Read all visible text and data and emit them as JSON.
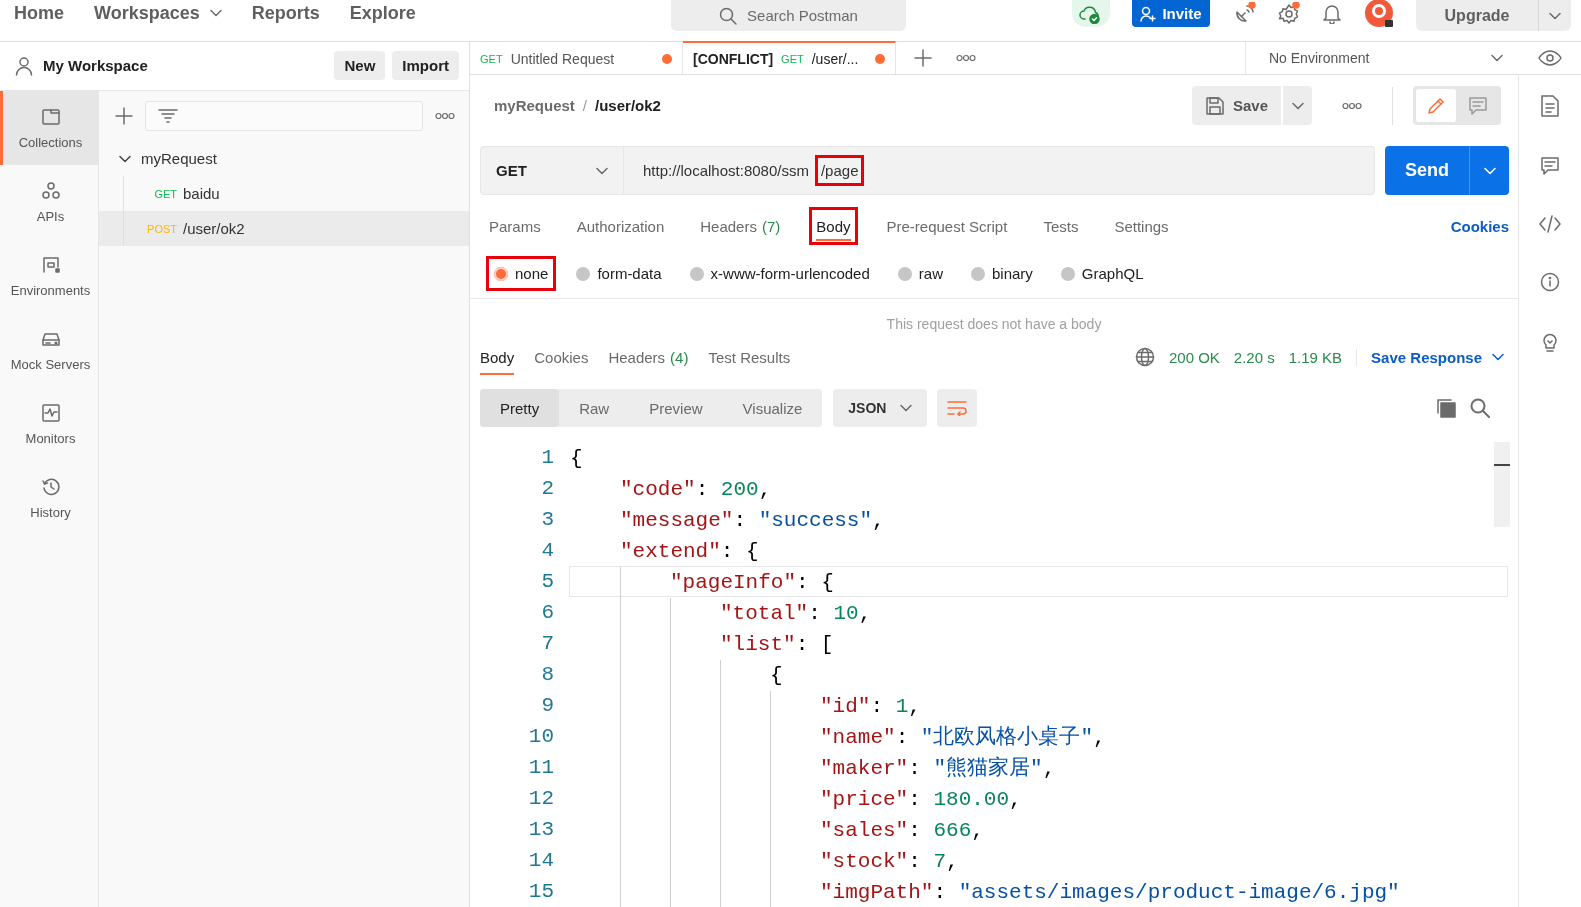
{
  "top_nav": {
    "items": [
      {
        "label": "Home",
        "dropdown": false
      },
      {
        "label": "Workspaces",
        "dropdown": true
      },
      {
        "label": "Reports",
        "dropdown": false
      },
      {
        "label": "Explore",
        "dropdown": false
      }
    ],
    "search": {
      "placeholder": "Search Postman"
    },
    "invite": "Invite",
    "upgrade": "Upgrade"
  },
  "workspace": {
    "name": "My Workspace",
    "buttons": [
      "New",
      "Import"
    ]
  },
  "sidebar": {
    "items": [
      {
        "label": "Collections",
        "kind": "collections",
        "selected": true
      },
      {
        "label": "APIs",
        "kind": "apis",
        "selected": false
      },
      {
        "label": "Environments",
        "kind": "environments",
        "selected": false
      },
      {
        "label": "Mock Servers",
        "kind": "mock",
        "selected": false
      },
      {
        "label": "Monitors",
        "kind": "monitors",
        "selected": false
      },
      {
        "label": "History",
        "kind": "history",
        "selected": false
      }
    ]
  },
  "collections": [
    {
      "name": "myRequest",
      "expanded": true,
      "children": [
        {
          "method": "GET",
          "color": "#0cbb52",
          "name": "baidu",
          "selected": false
        },
        {
          "method": "POST",
          "color": "#ffb400",
          "name": "/user/ok2",
          "selected": true
        }
      ]
    }
  ],
  "tabs": [
    {
      "method": "GET",
      "color": "#0cbb52",
      "title": "Untitled Request",
      "unsaved": true,
      "selected": false
    },
    {
      "tag": "[CONFLICT]",
      "method": "GET",
      "color": "#0cbb52",
      "title": "/user/...",
      "unsaved": true,
      "selected": true
    }
  ],
  "environment": "No Environment",
  "request": {
    "breadcrumb": [
      "myRequest",
      "/user/ok2"
    ],
    "breadcrumb_separator": "/",
    "save": "Save",
    "editor_modes": [
      {
        "kind": "edit",
        "selected": true
      },
      {
        "kind": "comments",
        "selected": false
      }
    ],
    "method": "GET",
    "url_parts": [
      {
        "text": "http://localhost:8080/ssm",
        "annotated": false
      },
      {
        "text": "/page",
        "annotated": true
      }
    ],
    "send": "Send",
    "tabs": [
      {
        "label": "Params",
        "selected": false,
        "annotated": false
      },
      {
        "label": "Authorization",
        "selected": false,
        "annotated": false
      },
      {
        "label": "Headers",
        "count": "(7)",
        "selected": false,
        "annotated": false
      },
      {
        "label": "Body",
        "selected": true,
        "annotated": true
      },
      {
        "label": "Pre-request Script",
        "selected": false,
        "annotated": false
      },
      {
        "label": "Tests",
        "selected": false,
        "annotated": false
      },
      {
        "label": "Settings",
        "selected": false,
        "annotated": false
      }
    ],
    "cookies": "Cookies",
    "body_types": [
      {
        "label": "none",
        "selected": true,
        "annotated": true
      },
      {
        "label": "form-data",
        "selected": false,
        "annotated": false
      },
      {
        "label": "x-www-form-urlencoded",
        "selected": false,
        "annotated": false
      },
      {
        "label": "raw",
        "selected": false,
        "annotated": false
      },
      {
        "label": "binary",
        "selected": false,
        "annotated": false
      },
      {
        "label": "GraphQL",
        "selected": false,
        "annotated": false
      }
    ],
    "body_message": "This request does not have a body"
  },
  "response": {
    "tabs": [
      {
        "label": "Body",
        "selected": true
      },
      {
        "label": "Cookies",
        "selected": false
      },
      {
        "label": "Headers",
        "count": "(4)",
        "selected": false
      },
      {
        "label": "Test Results",
        "selected": false
      }
    ],
    "status": "200 OK",
    "time": "2.20 s",
    "size": "1.19 KB",
    "save": "Save Response",
    "views": [
      {
        "label": "Pretty",
        "selected": true
      },
      {
        "label": "Raw",
        "selected": false
      },
      {
        "label": "Preview",
        "selected": false
      },
      {
        "label": "Visualize",
        "selected": false
      }
    ],
    "format": "JSON",
    "lines": [
      {
        "number": "1",
        "current": false,
        "tokens": [
          {
            "kind": "punct",
            "text": "{"
          }
        ]
      },
      {
        "number": "2",
        "current": false,
        "tokens": [
          {
            "kind": "key",
            "text": "\"code\""
          },
          {
            "kind": "punct",
            "text": ": "
          },
          {
            "kind": "num",
            "text": "200"
          },
          {
            "kind": "punct",
            "text": ","
          }
        ]
      },
      {
        "number": "3",
        "current": false,
        "tokens": [
          {
            "kind": "key",
            "text": "\"message\""
          },
          {
            "kind": "punct",
            "text": ": "
          },
          {
            "kind": "str",
            "text": "\"success\""
          },
          {
            "kind": "punct",
            "text": ","
          }
        ]
      },
      {
        "number": "4",
        "current": false,
        "tokens": [
          {
            "kind": "key",
            "text": "\"extend\""
          },
          {
            "kind": "punct",
            "text": ": {"
          }
        ]
      },
      {
        "number": "5",
        "current": true,
        "tokens": [
          {
            "kind": "key",
            "text": "\"pageInfo\""
          },
          {
            "kind": "punct",
            "text": ": {"
          }
        ]
      },
      {
        "number": "6",
        "current": false,
        "tokens": [
          {
            "kind": "key",
            "text": "\"total\""
          },
          {
            "kind": "punct",
            "text": ": "
          },
          {
            "kind": "num",
            "text": "10"
          },
          {
            "kind": "punct",
            "text": ","
          }
        ]
      },
      {
        "number": "7",
        "current": false,
        "tokens": [
          {
            "kind": "key",
            "text": "\"list\""
          },
          {
            "kind": "punct",
            "text": ": ["
          }
        ]
      },
      {
        "number": "8",
        "current": false,
        "tokens": [
          {
            "kind": "punct",
            "text": "{"
          }
        ]
      },
      {
        "number": "9",
        "current": false,
        "tokens": [
          {
            "kind": "key",
            "text": "\"id\""
          },
          {
            "kind": "punct",
            "text": ": "
          },
          {
            "kind": "num",
            "text": "1"
          },
          {
            "kind": "punct",
            "text": ","
          }
        ]
      },
      {
        "number": "10",
        "current": false,
        "tokens": [
          {
            "kind": "key",
            "text": "\"name\""
          },
          {
            "kind": "punct",
            "text": ": "
          },
          {
            "kind": "str",
            "text": "\"北欧风格小桌子\""
          },
          {
            "kind": "punct",
            "text": ","
          }
        ]
      },
      {
        "number": "11",
        "current": false,
        "tokens": [
          {
            "kind": "key",
            "text": "\"maker\""
          },
          {
            "kind": "punct",
            "text": ": "
          },
          {
            "kind": "str",
            "text": "\"熊猫家居\""
          },
          {
            "kind": "punct",
            "text": ","
          }
        ]
      },
      {
        "number": "12",
        "current": false,
        "tokens": [
          {
            "kind": "key",
            "text": "\"price\""
          },
          {
            "kind": "punct",
            "text": ": "
          },
          {
            "kind": "num",
            "text": "180.00"
          },
          {
            "kind": "punct",
            "text": ","
          }
        ]
      },
      {
        "number": "13",
        "current": false,
        "tokens": [
          {
            "kind": "key",
            "text": "\"sales\""
          },
          {
            "kind": "punct",
            "text": ": "
          },
          {
            "kind": "num",
            "text": "666"
          },
          {
            "kind": "punct",
            "text": ","
          }
        ]
      },
      {
        "number": "14",
        "current": false,
        "tokens": [
          {
            "kind": "key",
            "text": "\"stock\""
          },
          {
            "kind": "punct",
            "text": ": "
          },
          {
            "kind": "num",
            "text": "7"
          },
          {
            "kind": "punct",
            "text": ","
          }
        ]
      },
      {
        "number": "15",
        "current": false,
        "tokens": [
          {
            "kind": "key",
            "text": "\"imgPath\""
          },
          {
            "kind": "punct",
            "text": ": "
          },
          {
            "kind": "str",
            "text": "\"assets/images/product-image/6.jpg\""
          }
        ]
      }
    ]
  }
}
